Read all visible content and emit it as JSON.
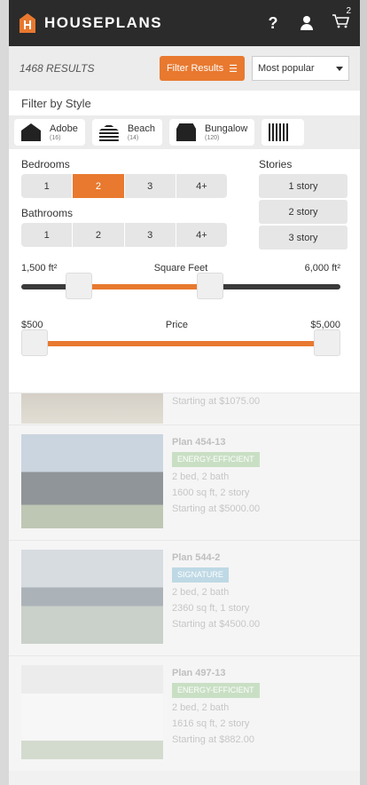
{
  "header": {
    "brand": "HOUSEPLANS",
    "help_icon": "?",
    "cart_count": "2"
  },
  "results_bar": {
    "count": "1468 RESULTS",
    "filter_button": "Filter Results",
    "sort_value": "Most popular"
  },
  "style_filter": {
    "title": "Filter by Style",
    "styles": [
      {
        "name": "Adobe",
        "count": "(16)",
        "icon": "adobe-house-icon"
      },
      {
        "name": "Beach",
        "count": "(14)",
        "icon": "beach-house-icon"
      },
      {
        "name": "Bungalow",
        "count": "(120)",
        "icon": "bungalow-house-icon"
      }
    ]
  },
  "filters": {
    "bedrooms_label": "Bedrooms",
    "bedrooms": [
      "1",
      "2",
      "3",
      "4+"
    ],
    "bedrooms_selected": "2",
    "bathrooms_label": "Bathrooms",
    "bathrooms": [
      "1",
      "2",
      "3",
      "4+"
    ],
    "stories_label": "Stories",
    "stories": [
      "1 story",
      "2 story",
      "3 story"
    ],
    "sqft": {
      "min_label": "1,500 ft²",
      "title": "Square Feet",
      "max_label": "6,000 ft²",
      "low": 0.15,
      "high": 0.6
    },
    "price": {
      "min_label": "$500",
      "title": "Price",
      "max_label": "$5,000",
      "low": 0.0,
      "high": 1.0
    }
  },
  "results": [
    {
      "name": "",
      "badge": "",
      "beds": "",
      "sqft": "",
      "price": "Starting at $1075.00"
    },
    {
      "name": "Plan 454-13",
      "badge": "ENERGY-EFFICIENT",
      "beds": "2 bed, 2 bath",
      "sqft": "1600 sq ft, 2 story",
      "price": "Starting at $5000.00"
    },
    {
      "name": "Plan 544-2",
      "badge": "SIGNATURE",
      "beds": "2 bed, 2 bath",
      "sqft": "2360 sq ft, 1 story",
      "price": "Starting at $4500.00"
    },
    {
      "name": "Plan 497-13",
      "badge": "ENERGY-EFFICIENT",
      "beds": "2 bed, 2 bath",
      "sqft": "1616 sq ft, 2 story",
      "price": "Starting at $882.00"
    }
  ],
  "colors": {
    "accent": "#e8792f",
    "header": "#2b2b2b"
  }
}
